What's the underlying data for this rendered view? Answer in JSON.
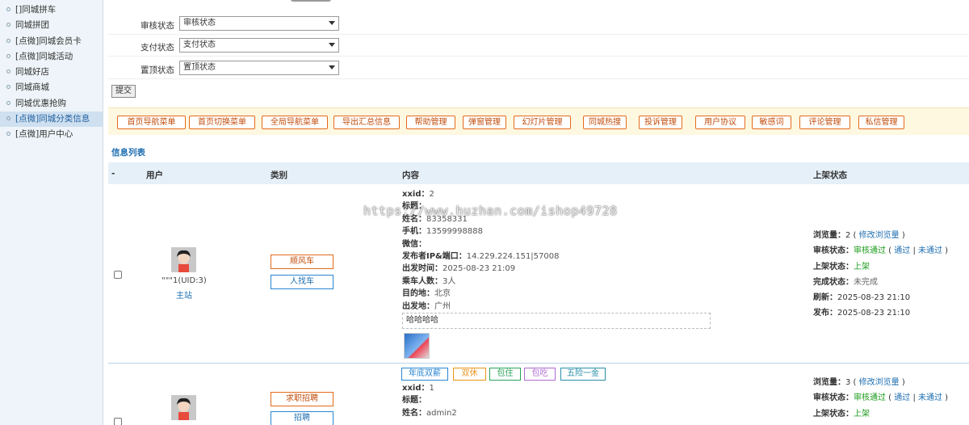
{
  "sidebar": {
    "items": [
      {
        "label": "[]同城拼车"
      },
      {
        "label": "同城拼团"
      },
      {
        "label": "[点微]同城会员卡"
      },
      {
        "label": "[点微]同城活动"
      },
      {
        "label": "同城好店"
      },
      {
        "label": "同城商城"
      },
      {
        "label": "同城优惠抢购"
      },
      {
        "label": "[点微]同城分类信息",
        "active": true
      },
      {
        "label": "[点微]用户中心"
      }
    ]
  },
  "filters": [
    {
      "label": "审核状态",
      "value": "审核状态"
    },
    {
      "label": "支付状态",
      "value": "支付状态"
    },
    {
      "label": "置顶状态",
      "value": "置顶状态"
    }
  ],
  "submit_label": "提交",
  "toolbar": [
    "首页导航菜单",
    "首页切换菜单",
    "全局导航菜单",
    "导出汇总信息",
    "帮助管理",
    "弹窗管理",
    "幻灯片管理",
    "同城热搜",
    "投诉管理",
    "用户协议",
    "敏感词",
    "评论管理",
    "私信管理"
  ],
  "section_title": "信息列表",
  "table_header": {
    "select": "-",
    "user": "用户",
    "category": "类别",
    "content": "内容",
    "status": "上架状态"
  },
  "rows": [
    {
      "user_name": "\"\"\"1(UID:3)",
      "user_site": "主站",
      "categories": [
        "顺风车",
        "人找车"
      ],
      "content": [
        {
          "k": "xxid：",
          "v": "2"
        },
        {
          "k": "标题：",
          "v": ""
        },
        {
          "k": "姓名：",
          "v": "83358331"
        },
        {
          "k": "手机：",
          "v": "13599998888"
        },
        {
          "k": "微信：",
          "v": ""
        },
        {
          "k": "发布者IP&端口：",
          "v": "14.229.224.151|57008"
        },
        {
          "k": "出发时间：",
          "v": "2025-08-23 21:09"
        },
        {
          "k": "乘车人数：",
          "v": "3人"
        },
        {
          "k": "目的地：",
          "v": "北京"
        },
        {
          "k": "出发地：",
          "v": "广州"
        }
      ],
      "description": "哈哈哈哈",
      "status": {
        "views_label": "浏览量：",
        "views": "2",
        "views_edit": "修改浏览量",
        "audit_label": "审核状态：",
        "audit": "审核通过",
        "pass": "通过",
        "reject": "未通过",
        "shelf_label": "上架状态：",
        "shelf": "上架",
        "done_label": "完成状态：",
        "done": "未完成",
        "refresh_label": "刷新：",
        "refresh": "2025-08-23 21:10",
        "publish_label": "发布：",
        "publish": "2025-08-23 21:10"
      }
    },
    {
      "user_name": "",
      "categories": [
        "求职招聘",
        "招聘"
      ],
      "tags": [
        {
          "label": "年底双薪",
          "color": "#2a86d1"
        },
        {
          "label": "双休",
          "color": "#e8951c"
        },
        {
          "label": "包住",
          "color": "#2aa35a"
        },
        {
          "label": "包吃",
          "color": "#b06ad1"
        },
        {
          "label": "五险一金",
          "color": "#2a8fa8"
        }
      ],
      "content": [
        {
          "k": "xxid：",
          "v": "1"
        },
        {
          "k": "标题：",
          "v": ""
        },
        {
          "k": "姓名：",
          "v": "admin2"
        }
      ],
      "status": {
        "views_label": "浏览量：",
        "views": "3",
        "views_edit": "修改浏览量",
        "audit_label": "审核状态：",
        "audit": "审核通过",
        "pass": "通过",
        "reject": "未通过",
        "shelf_label": "上架状态：",
        "shelf": "上架"
      }
    }
  ],
  "watermark": "https://www.huzhan.com/ishop49728"
}
